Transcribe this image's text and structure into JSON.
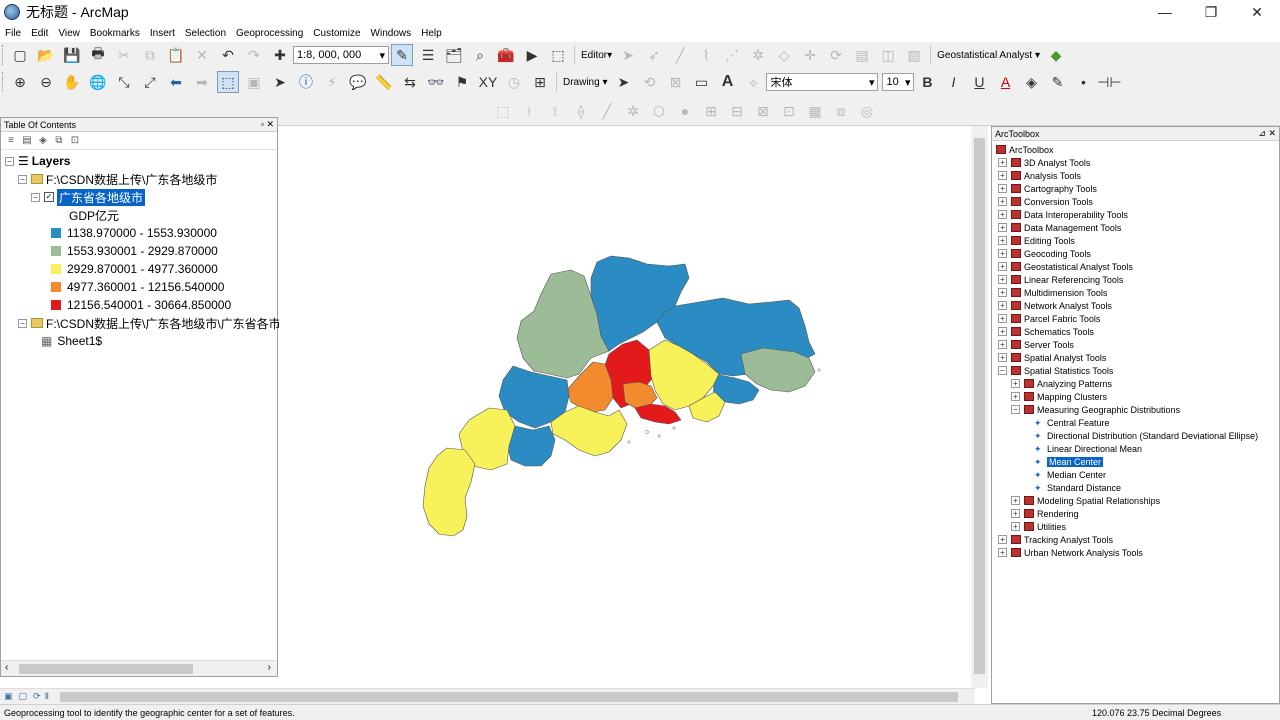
{
  "window": {
    "title": "无标题 - ArcMap",
    "minimize": "—",
    "maximize": "❐",
    "close": "✕"
  },
  "menu": [
    "File",
    "Edit",
    "View",
    "Bookmarks",
    "Insert",
    "Selection",
    "Geoprocessing",
    "Customize",
    "Windows",
    "Help"
  ],
  "toolbar": {
    "scale": "1:8, 000, 000",
    "editor": "Editor▾",
    "geostat": "Geostatistical Analyst ▾",
    "drawing": "Drawing ▾",
    "font": "宋体",
    "fontsize": "10",
    "bold": "B",
    "italic": "I",
    "underline": "U"
  },
  "toc": {
    "header": "Table Of Contents",
    "layers": "Layers",
    "group1": "F:\\CSDN数据上传\\广东各地级市",
    "layer1": "广东省各地级市",
    "field": "GDP亿元",
    "classes": [
      {
        "label": "1138.970000 - 1553.930000",
        "color": "#2b8cc4"
      },
      {
        "label": "1553.930001 - 2929.870000",
        "color": "#9cbc98"
      },
      {
        "label": "2929.870001 - 4977.360000",
        "color": "#f8f25a"
      },
      {
        "label": "4977.360001 - 12156.540000",
        "color": "#f28a2e"
      },
      {
        "label": "12156.540001 - 30664.850000",
        "color": "#e31a1c"
      }
    ],
    "group2": "F:\\CSDN数据上传\\广东各地级市\\广东省各市",
    "table": "Sheet1$"
  },
  "arctoolbox": {
    "header": "ArcToolbox",
    "root": "ArcToolbox",
    "toolboxes": [
      "3D Analyst Tools",
      "Analysis Tools",
      "Cartography Tools",
      "Conversion Tools",
      "Data Interoperability Tools",
      "Data Management Tools",
      "Editing Tools",
      "Geocoding Tools",
      "Geostatistical Analyst Tools",
      "Linear Referencing Tools",
      "Multidimension Tools",
      "Network Analyst Tools",
      "Parcel Fabric Tools",
      "Schematics Tools",
      "Server Tools",
      "Spatial Analyst Tools",
      "Spatial Statistics Tools"
    ],
    "spatial_sub": [
      "Analyzing Patterns",
      "Mapping Clusters",
      "Measuring Geographic Distributions"
    ],
    "measuring_tools": [
      "Central Feature",
      "Directional Distribution (Standard Deviational Ellipse)",
      "Linear Directional Mean",
      "Mean Center",
      "Median Center",
      "Standard Distance"
    ],
    "spatial_sub2": [
      "Modeling Spatial Relationships",
      "Rendering",
      "Utilities"
    ],
    "tail": [
      "Tracking Analyst Tools",
      "Urban Network Analysis Tools"
    ]
  },
  "status": {
    "message": "Geoprocessing tool to identify the geographic center for a set of features.",
    "coords": "120.076  23.75 Decimal Degrees"
  }
}
